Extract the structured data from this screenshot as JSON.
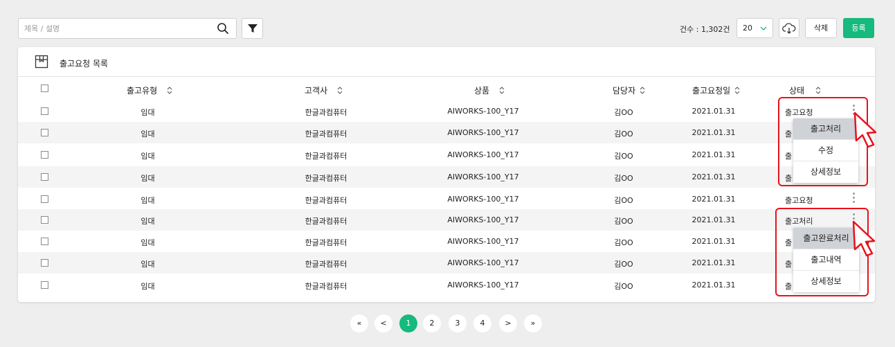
{
  "search": {
    "placeholder": "제목 / 설명",
    "value": ""
  },
  "toolbar": {
    "count_label": "건수 : 1,302건",
    "page_size": "20",
    "delete_label": "삭제",
    "register_label": "등록"
  },
  "panel": {
    "title": "출고요청 목록"
  },
  "table": {
    "headers": [
      "출고유형",
      "고객사",
      "상품",
      "담당자",
      "출고요청일",
      "상태"
    ],
    "rows": [
      {
        "type": "임대",
        "customer": "한글과컴퓨터",
        "product": "AIWORKS-100_Y17",
        "manager": "김OO",
        "date": "2021.01.31",
        "status": "출고요청"
      },
      {
        "type": "임대",
        "customer": "한글과컴퓨터",
        "product": "AIWORKS-100_Y17",
        "manager": "김OO",
        "date": "2021.01.31",
        "status": "출"
      },
      {
        "type": "임대",
        "customer": "한글과컴퓨터",
        "product": "AIWORKS-100_Y17",
        "manager": "김OO",
        "date": "2021.01.31",
        "status": "출"
      },
      {
        "type": "임대",
        "customer": "한글과컴퓨터",
        "product": "AIWORKS-100_Y17",
        "manager": "김OO",
        "date": "2021.01.31",
        "status": "출"
      },
      {
        "type": "임대",
        "customer": "한글과컴퓨터",
        "product": "AIWORKS-100_Y17",
        "manager": "김OO",
        "date": "2021.01.31",
        "status": "출고요청"
      },
      {
        "type": "임대",
        "customer": "한글과컴퓨터",
        "product": "AIWORKS-100_Y17",
        "manager": "김OO",
        "date": "2021.01.31",
        "status": "출고처리"
      },
      {
        "type": "임대",
        "customer": "한글과컴퓨터",
        "product": "AIWORKS-100_Y17",
        "manager": "김OO",
        "date": "2021.01.31",
        "status": "출"
      },
      {
        "type": "임대",
        "customer": "한글과컴퓨터",
        "product": "AIWORKS-100_Y17",
        "manager": "김OO",
        "date": "2021.01.31",
        "status": "출"
      },
      {
        "type": "임대",
        "customer": "한글과컴퓨터",
        "product": "AIWORKS-100_Y17",
        "manager": "김OO",
        "date": "2021.01.31",
        "status": "출"
      }
    ]
  },
  "menu_request": {
    "items": [
      "출고처리",
      "수정",
      "상세정보"
    ],
    "active": "출고처리"
  },
  "menu_processed": {
    "items": [
      "출고완료처리",
      "출고내역",
      "상세정보"
    ],
    "active": "출고완료처리"
  },
  "pagination": {
    "first": "«",
    "prev": "<",
    "pages": [
      "1",
      "2",
      "3",
      "4"
    ],
    "current": "1",
    "next": ">",
    "last": "»"
  },
  "colors": {
    "accent": "#16b97e",
    "highlight": "#e8111c",
    "cursor": "#e8111c"
  }
}
